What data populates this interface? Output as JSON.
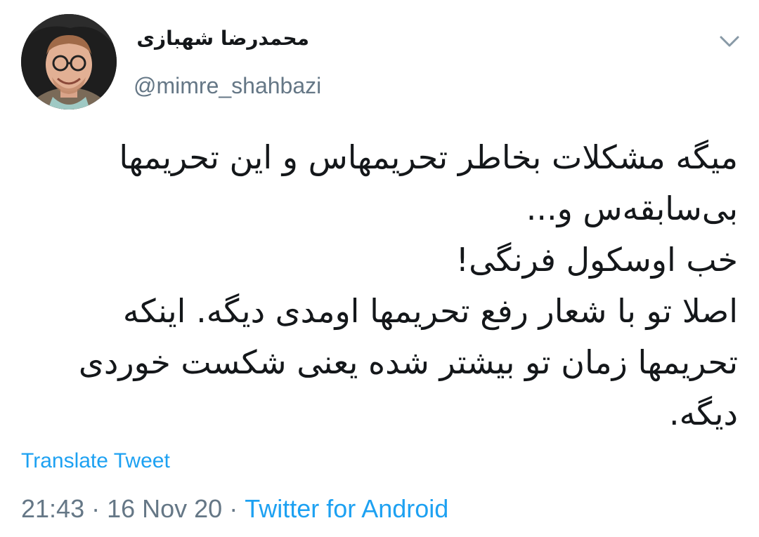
{
  "user": {
    "display_name": "محمدرضا شهبازی",
    "handle": "@mimre_shahbazi"
  },
  "tweet": {
    "lines": [
      "میگه مشکلات بخاطر تحریمهاس و این تحریمها",
      "بی‌سابقه‌س و...",
      "خب اوسکول فرنگی!",
      "اصلا تو با شعار رفع تحریمها اومدی دیگه. اینکه",
      "تحریمها زمان تو بیشتر شده یعنی شکست خوردی",
      "دیگه."
    ]
  },
  "actions": {
    "translate_label": "Translate Tweet"
  },
  "meta": {
    "time": "21:43",
    "separator": "·",
    "date": "16 Nov 20",
    "source": "Twitter for Android"
  },
  "icons": {
    "menu": "chevron-down-icon",
    "avatar": "avatar-photo"
  },
  "colors": {
    "link": "#1da1f2",
    "secondary_text": "#657786",
    "primary_text": "#14171a"
  }
}
